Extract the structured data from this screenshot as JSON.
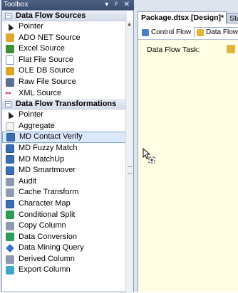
{
  "toolbox": {
    "title": "Toolbox",
    "controls": "▾ ᵖ ✕",
    "sections": [
      {
        "label": "Data Flow Sources",
        "items": [
          {
            "label": "Pointer",
            "icon": "pointer-icon"
          },
          {
            "label": "ADO NET Source",
            "icon": "ado-net-source-icon"
          },
          {
            "label": "Excel Source",
            "icon": "excel-source-icon"
          },
          {
            "label": "Flat File Source",
            "icon": "flat-file-source-icon"
          },
          {
            "label": "OLE DB Source",
            "icon": "ole-db-source-icon"
          },
          {
            "label": "Raw File Source",
            "icon": "raw-file-source-icon"
          },
          {
            "label": "XML Source",
            "icon": "xml-source-icon"
          }
        ]
      },
      {
        "label": "Data Flow Transformations",
        "items": [
          {
            "label": "Pointer",
            "icon": "pointer-icon"
          },
          {
            "label": "Aggregate",
            "icon": "aggregate-icon"
          },
          {
            "label": "MD Contact Verify",
            "icon": "md-contact-verify-icon",
            "selected": true
          },
          {
            "label": "MD Fuzzy Match",
            "icon": "md-fuzzy-match-icon"
          },
          {
            "label": "MD MatchUp",
            "icon": "md-matchup-icon"
          },
          {
            "label": "MD Smartmover",
            "icon": "md-smartmover-icon"
          },
          {
            "label": "Audit",
            "icon": "audit-icon"
          },
          {
            "label": "Cache Transform",
            "icon": "cache-transform-icon"
          },
          {
            "label": "Character Map",
            "icon": "character-map-icon"
          },
          {
            "label": "Conditional Split",
            "icon": "conditional-split-icon"
          },
          {
            "label": "Copy Column",
            "icon": "copy-column-icon"
          },
          {
            "label": "Data Conversion",
            "icon": "data-conversion-icon"
          },
          {
            "label": "Data Mining Query",
            "icon": "data-mining-query-icon"
          },
          {
            "label": "Derived Column",
            "icon": "derived-column-icon"
          },
          {
            "label": "Export Column",
            "icon": "export-column-icon"
          }
        ]
      }
    ]
  },
  "document": {
    "active_tab": "Package.dtsx [Design]*",
    "next_tab": "Start Pa",
    "designer_tabs": [
      "Control Flow",
      "Data Flow"
    ],
    "task_label": "Data Flow Task:"
  }
}
